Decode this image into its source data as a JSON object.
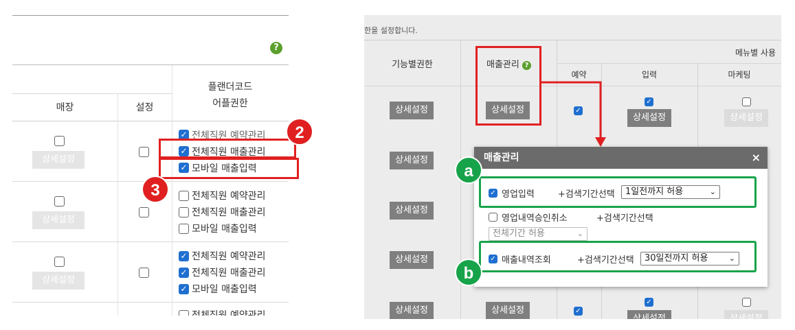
{
  "left": {
    "help_icon": "?",
    "headers": {
      "store": "매장",
      "setting": "설정",
      "plander_line1": "플랜더코드",
      "plander_line2": "어플권한"
    },
    "detail_button": "상세설정",
    "options": [
      "전체직원 예약관리",
      "전체직원 매출관리",
      "모바일 매출입력"
    ],
    "rows": [
      {
        "checked": [
          true,
          true,
          true
        ]
      },
      {
        "checked": [
          false,
          false,
          false
        ]
      },
      {
        "checked": [
          true,
          true,
          true
        ]
      }
    ],
    "badge2": "2",
    "badge3": "3"
  },
  "right": {
    "top_text": "한을 설정합니다.",
    "headers": {
      "func": "기능별권한",
      "sales": "매출관리",
      "menu": "메뉴별 사용",
      "reserve": "예약",
      "input": "입력",
      "marketing": "마케팅"
    },
    "detail_button": "상세설정",
    "popup": {
      "title": "매출관리",
      "close": "×",
      "item1_label": "영업입력",
      "item1_period": "+검색기간선택",
      "item1_select": "1일전까지 허용",
      "item2_label": "영업내역승인취소",
      "item2_period": "+검색기간선택",
      "item2_select": "전체기간 허용",
      "item3_label": "매출내역조회",
      "item3_period": "+검색기간선택",
      "item3_select": "30일전까지 허용"
    },
    "badge_a": "a",
    "badge_b": "b"
  },
  "colors": {
    "red": "#e02020",
    "green": "#17a34a",
    "checkbox_blue": "#1f6fd0"
  }
}
